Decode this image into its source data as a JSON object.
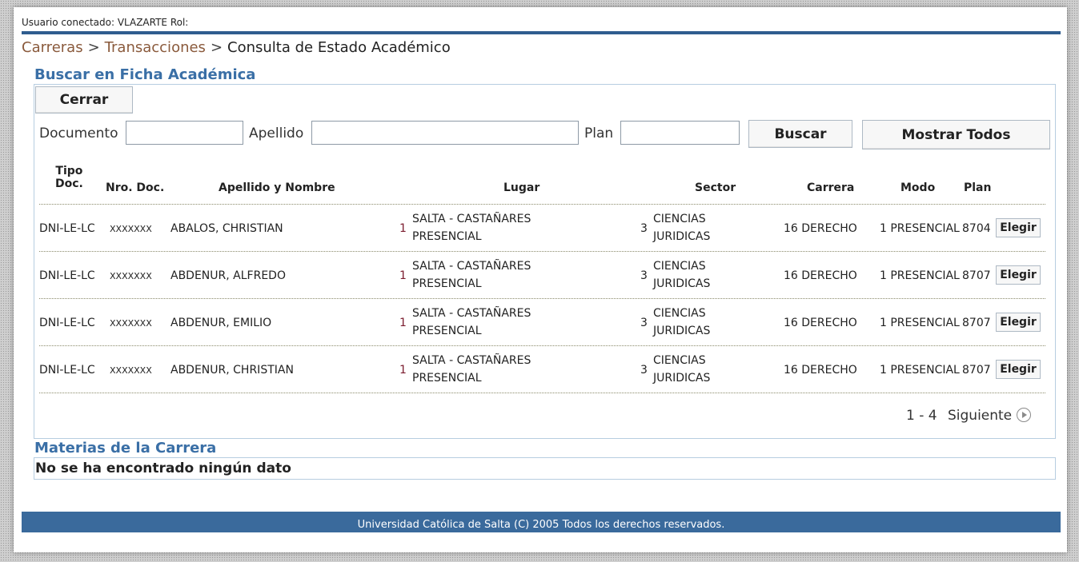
{
  "user_bar": "Usuario conectado: VLAZARTE Rol:",
  "breadcrumb": {
    "items": [
      "Carreras",
      "Transacciones"
    ],
    "separator": ">",
    "current": "Consulta de Estado Académico"
  },
  "search_section": {
    "title": "Buscar en Ficha Académica",
    "close_label": "Cerrar",
    "fields": {
      "documento": {
        "label": "Documento",
        "value": ""
      },
      "apellido": {
        "label": "Apellido",
        "value": ""
      },
      "plan": {
        "label": "Plan",
        "value": ""
      }
    },
    "search_label": "Buscar",
    "show_all_label": "Mostrar Todos"
  },
  "table": {
    "headers": {
      "tipo_doc_line1": "Tipo",
      "tipo_doc_line2": "Doc.",
      "nro_doc": "Nro. Doc.",
      "nombre": "Apellido y Nombre",
      "lugar": "Lugar",
      "sector": "Sector",
      "carrera": "Carrera",
      "modo": "Modo",
      "plan": "Plan"
    },
    "rows": [
      {
        "tipo": "DNI-LE-LC",
        "nro": "XXXXXXX",
        "nombre": "ABALOS, CHRISTIAN",
        "lugar_num": "1",
        "lugar1": "SALTA - CASTAÑARES",
        "lugar2": "PRESENCIAL",
        "sector_num": "3",
        "sector1": "CIENCIAS",
        "sector2": "JURIDICAS",
        "carrera": "16 DERECHO",
        "modo": "1 PRESENCIAL",
        "plan": "8704",
        "action": "Elegir"
      },
      {
        "tipo": "DNI-LE-LC",
        "nro": "XXXXXXX",
        "nombre": "ABDENUR, ALFREDO",
        "lugar_num": "1",
        "lugar1": "SALTA - CASTAÑARES",
        "lugar2": "PRESENCIAL",
        "sector_num": "3",
        "sector1": "CIENCIAS",
        "sector2": "JURIDICAS",
        "carrera": "16 DERECHO",
        "modo": "1 PRESENCIAL",
        "plan": "8707",
        "action": "Elegir"
      },
      {
        "tipo": "DNI-LE-LC",
        "nro": "XXXXXXX",
        "nombre": "ABDENUR, EMILIO",
        "lugar_num": "1",
        "lugar1": "SALTA - CASTAÑARES",
        "lugar2": "PRESENCIAL",
        "sector_num": "3",
        "sector1": "CIENCIAS",
        "sector2": "JURIDICAS",
        "carrera": "16 DERECHO",
        "modo": "1 PRESENCIAL",
        "plan": "8707",
        "action": "Elegir"
      },
      {
        "tipo": "DNI-LE-LC",
        "nro": "XXXXXXX",
        "nombre": "ABDENUR, CHRISTIAN",
        "lugar_num": "1",
        "lugar1": "SALTA - CASTAÑARES",
        "lugar2": "PRESENCIAL",
        "sector_num": "3",
        "sector1": "CIENCIAS",
        "sector2": "JURIDICAS",
        "carrera": "16 DERECHO",
        "modo": "1 PRESENCIAL",
        "plan": "8707",
        "action": "Elegir"
      }
    ]
  },
  "pagination": {
    "range": "1 - 4",
    "next_label": "Siguiente",
    "next_icon": "play-circle-icon"
  },
  "materias_section": {
    "title": "Materias de la Carrera",
    "empty_message": "No se ha encontrado ningún dato"
  },
  "footer": "Universidad Católica de Salta (C) 2005 Todos los derechos reservados.",
  "colors": {
    "accent": "#3a6fa6",
    "footer_bg": "#3a6a9c",
    "breadcrumb_link": "#8a5a3c",
    "number": "#7b1c2e"
  }
}
